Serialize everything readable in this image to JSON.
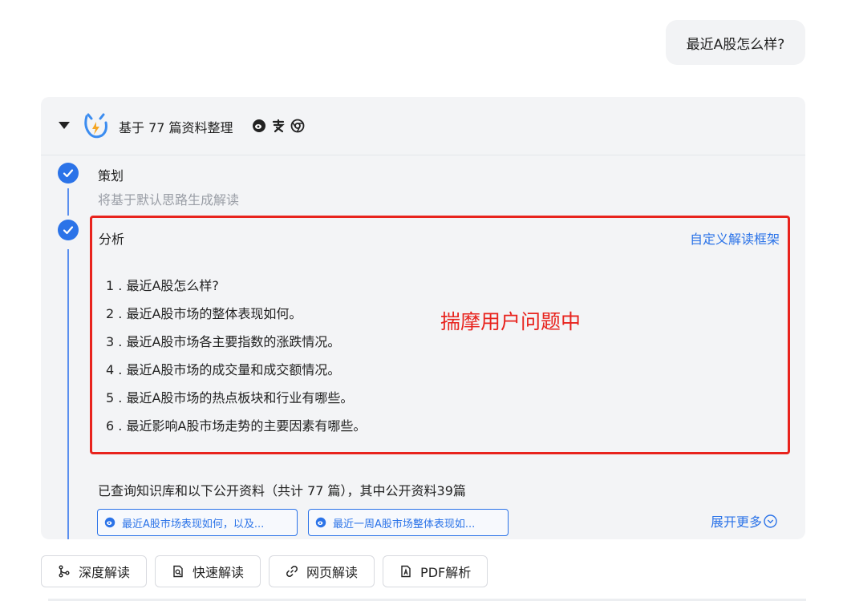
{
  "user_message": "最近A股怎么样?",
  "panel": {
    "header_title": "基于 77 篇资料整理",
    "source_icons": [
      "weibo-icon",
      "zhihu-icon",
      "chrome-icon"
    ],
    "steps": [
      {
        "title": "策划",
        "subtitle": "将基于默认思路生成解读"
      },
      {
        "title": "分析",
        "action": "自定义解读框架"
      }
    ],
    "questions": [
      "1 . 最近A股怎么样?",
      "2 . 最近A股市场的整体表现如何。",
      "3 . 最近A股市场各主要指数的涨跌情况。",
      "4 . 最近A股市场的成交量和成交额情况。",
      "5 . 最近A股市场的热点板块和行业有哪些。",
      "6 . 最近影响A股市场走势的主要因素有哪些。"
    ],
    "thinking_status": "揣摩用户问题中",
    "summary": "已查询知识库和以下公开资料（共计 77 篇），其中公开资料39篇",
    "source_chips": [
      "最近A股市场表现如何，以及...",
      "最近一周A股市场整体表现如..."
    ],
    "more_label": "展开更多"
  },
  "actions": [
    "深度解读",
    "快速解读",
    "网页解读",
    "PDF解析"
  ],
  "colors": {
    "accent": "#2b73e8",
    "highlight": "#e8231d",
    "panel_bg": "#f3f4f6"
  }
}
